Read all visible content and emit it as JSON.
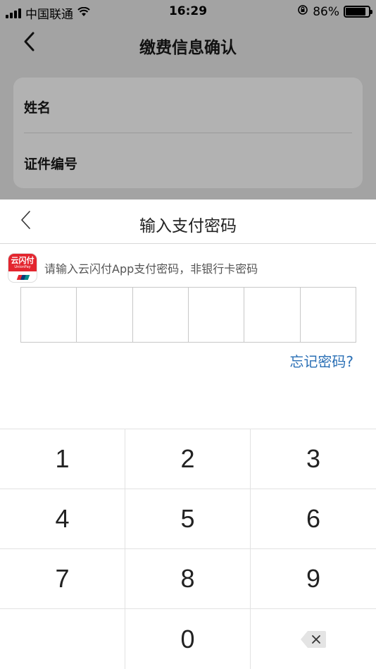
{
  "status_bar": {
    "carrier": "中国联通",
    "time": "16:29",
    "battery_text": "86%",
    "battery_level": 0.86
  },
  "nav": {
    "back_icon": "chevron-left-icon",
    "title": "缴费信息确认"
  },
  "info_card": {
    "rows": [
      {
        "label": "姓名"
      },
      {
        "label": "证件编号"
      }
    ]
  },
  "payment_sheet": {
    "title": "输入支付密码",
    "logo_text": "云闪付",
    "logo_sub": "UnionPay",
    "hint": "请输入云闪付App支付密码，非银行卡密码",
    "pin_length": 6,
    "forgot_label": "忘记密码?"
  },
  "keypad": {
    "rows": [
      [
        "1",
        "2",
        "3"
      ],
      [
        "4",
        "5",
        "6"
      ],
      [
        "7",
        "8",
        "9"
      ],
      [
        "",
        "0",
        "delete-icon"
      ]
    ]
  }
}
